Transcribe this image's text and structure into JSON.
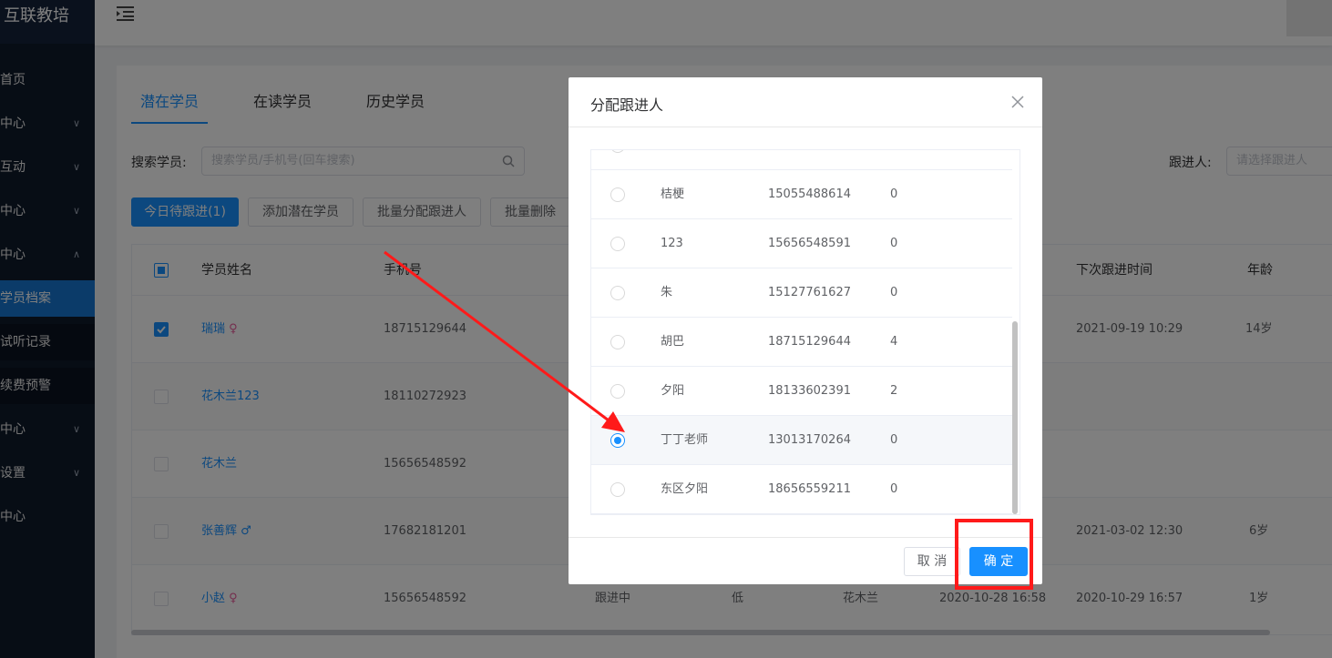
{
  "sidebar": {
    "brand": "互联教培",
    "items": [
      {
        "label": "首页"
      },
      {
        "label": "中心"
      },
      {
        "label": "互动"
      },
      {
        "label": "中心"
      },
      {
        "label": "中心"
      },
      {
        "label": "学员档案"
      },
      {
        "label": "试听记录"
      },
      {
        "label": "续费预警"
      },
      {
        "label": "中心"
      },
      {
        "label": "设置"
      },
      {
        "label": "中心"
      }
    ]
  },
  "tabs": [
    "潜在学员",
    "在读学员",
    "历史学员"
  ],
  "search": {
    "label": "搜索学员:",
    "placeholder": "搜索学员/手机号(回车搜索)"
  },
  "follow_filter": {
    "label": "跟进人:",
    "placeholder": "请选择跟进人"
  },
  "toolbar": {
    "today_follow": "今日待跟进(1)",
    "add_potential": "添加潜在学员",
    "batch_assign": "批量分配跟进人",
    "batch_delete": "批量删除"
  },
  "table": {
    "headers": {
      "name": "学员姓名",
      "phone": "手机号",
      "next_time": "下次跟进时间",
      "age": "年龄"
    },
    "rows": [
      {
        "name": "瑞瑞",
        "gender": "♀",
        "phone": "18715129644",
        "next_time": "2021-09-19 10:29",
        "age": "14岁",
        "status": "",
        "intent": "",
        "follower": "",
        "created": ""
      },
      {
        "name": "花木兰123",
        "gender": "",
        "phone": "18110272923",
        "next_time": "",
        "age": "",
        "status": "",
        "intent": "",
        "follower": "",
        "created": ""
      },
      {
        "name": "花木兰",
        "gender": "",
        "phone": "15656548592",
        "next_time": "",
        "age": "",
        "status": "",
        "intent": "",
        "follower": "",
        "created": ""
      },
      {
        "name": "张善辉",
        "gender": "♂",
        "phone": "17682181201",
        "next_time": "2021-03-02 12:30",
        "age": "6岁",
        "status": "",
        "intent": "",
        "follower": "",
        "created": ""
      },
      {
        "name": "小赵",
        "gender": "♀",
        "phone": "15656548592",
        "next_time": "2020-10-29 16:57",
        "age": "1岁",
        "status": "跟进中",
        "intent": "低",
        "follower": "花木兰",
        "created": "2020-10-28 16:58"
      }
    ]
  },
  "modal": {
    "title": "分配跟进人",
    "rows": [
      {
        "name": "桔梗",
        "phone": "15055488614",
        "count": "0",
        "selected": false
      },
      {
        "name": "123",
        "phone": "15656548591",
        "count": "0",
        "selected": false
      },
      {
        "name": "朱",
        "phone": "15127761627",
        "count": "0",
        "selected": false
      },
      {
        "name": "胡巴",
        "phone": "18715129644",
        "count": "4",
        "selected": false
      },
      {
        "name": "夕阳",
        "phone": "18133602391",
        "count": "2",
        "selected": false
      },
      {
        "name": "丁丁老师",
        "phone": "13013170264",
        "count": "0",
        "selected": true
      },
      {
        "name": "东区夕阳",
        "phone": "18656559211",
        "count": "0",
        "selected": false
      }
    ],
    "cancel": "取 消",
    "confirm": "确 定"
  },
  "colors": {
    "primary": "#1890ff",
    "annotation": "#ff1a1a",
    "sidebar": "#0f1a2b"
  }
}
